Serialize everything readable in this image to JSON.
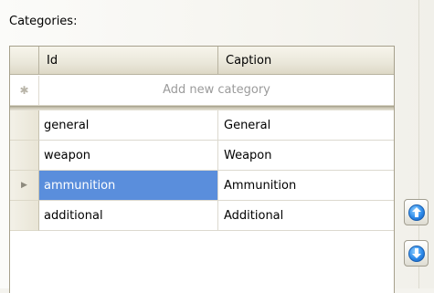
{
  "section_label": "Categories:",
  "grid": {
    "columns": [
      "Id",
      "Caption"
    ],
    "new_row_placeholder": "Add new category",
    "new_row_marker": "✱",
    "selected_marker": "▶",
    "rows": [
      {
        "id": "general",
        "caption": "General",
        "selected": false
      },
      {
        "id": "weapon",
        "caption": "Weapon",
        "selected": false
      },
      {
        "id": "ammunition",
        "caption": "Ammunition",
        "selected": true
      },
      {
        "id": "additional",
        "caption": "Additional",
        "selected": false
      }
    ]
  },
  "buttons": {
    "move_up_icon": "arrow-up-icon",
    "move_down_icon": "arrow-down-icon"
  },
  "colors": {
    "selection": "#5a8edc",
    "arrow_blue": "#2d8bea"
  }
}
